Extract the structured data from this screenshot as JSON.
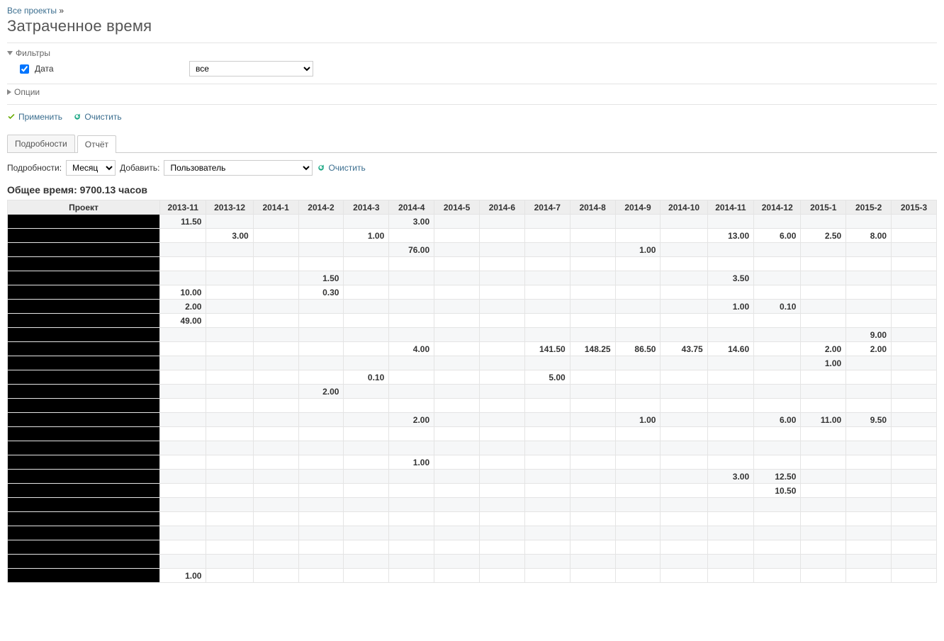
{
  "breadcrumb": {
    "link": "Все проекты",
    "sep": "»"
  },
  "page_title": "Затраченное время",
  "filters": {
    "legend": "Фильтры",
    "date_label": "Дата",
    "date_select_value": "все"
  },
  "options": {
    "legend": "Опции"
  },
  "actions": {
    "apply": "Применить",
    "clear": "Очистить"
  },
  "tabs": {
    "details": "Подробности",
    "report": "Отчёт"
  },
  "controls": {
    "details_label": "Подробности:",
    "details_value": "Месяц",
    "add_label": "Добавить:",
    "add_value": "Пользователь",
    "clear": "Очистить"
  },
  "total": {
    "label": "Общее время:",
    "value": "9700.13",
    "unit": "часов"
  },
  "table": {
    "project_header": "Проект",
    "columns": [
      "2013-11",
      "2013-12",
      "2014-1",
      "2014-2",
      "2014-3",
      "2014-4",
      "2014-5",
      "2014-6",
      "2014-7",
      "2014-8",
      "2014-9",
      "2014-10",
      "2014-11",
      "2014-12",
      "2015-1",
      "2015-2",
      "2015-3"
    ],
    "rows": [
      {
        "c": [
          "11.50",
          "",
          "",
          "",
          "",
          "3.00",
          "",
          "",
          "",
          "",
          "",
          "",
          "",
          "",
          "",
          "",
          ""
        ]
      },
      {
        "c": [
          "",
          "3.00",
          "",
          "",
          "1.00",
          "",
          "",
          "",
          "",
          "",
          "",
          "",
          "13.00",
          "6.00",
          "2.50",
          "8.00",
          ""
        ]
      },
      {
        "c": [
          "",
          "",
          "",
          "",
          "",
          "76.00",
          "",
          "",
          "",
          "",
          "1.00",
          "",
          "",
          "",
          "",
          "",
          ""
        ]
      },
      {
        "c": [
          "",
          "",
          "",
          "",
          "",
          "",
          "",
          "",
          "",
          "",
          "",
          "",
          "",
          "",
          "",
          "",
          ""
        ]
      },
      {
        "c": [
          "",
          "",
          "",
          "1.50",
          "",
          "",
          "",
          "",
          "",
          "",
          "",
          "",
          "3.50",
          "",
          "",
          "",
          ""
        ]
      },
      {
        "c": [
          "10.00",
          "",
          "",
          "0.30",
          "",
          "",
          "",
          "",
          "",
          "",
          "",
          "",
          "",
          "",
          "",
          "",
          ""
        ]
      },
      {
        "c": [
          "2.00",
          "",
          "",
          "",
          "",
          "",
          "",
          "",
          "",
          "",
          "",
          "",
          "1.00",
          "0.10",
          "",
          "",
          ""
        ]
      },
      {
        "c": [
          "49.00",
          "",
          "",
          "",
          "",
          "",
          "",
          "",
          "",
          "",
          "",
          "",
          "",
          "",
          "",
          "",
          ""
        ]
      },
      {
        "c": [
          "",
          "",
          "",
          "",
          "",
          "",
          "",
          "",
          "",
          "",
          "",
          "",
          "",
          "",
          "",
          "9.00",
          ""
        ]
      },
      {
        "c": [
          "",
          "",
          "",
          "",
          "",
          "4.00",
          "",
          "",
          "141.50",
          "148.25",
          "86.50",
          "43.75",
          "14.60",
          "",
          "2.00",
          "2.00",
          ""
        ]
      },
      {
        "c": [
          "",
          "",
          "",
          "",
          "",
          "",
          "",
          "",
          "",
          "",
          "",
          "",
          "",
          "",
          "1.00",
          "",
          ""
        ]
      },
      {
        "c": [
          "",
          "",
          "",
          "",
          "0.10",
          "",
          "",
          "",
          "5.00",
          "",
          "",
          "",
          "",
          "",
          "",
          "",
          ""
        ]
      },
      {
        "c": [
          "",
          "",
          "",
          "2.00",
          "",
          "",
          "",
          "",
          "",
          "",
          "",
          "",
          "",
          "",
          "",
          "",
          ""
        ]
      },
      {
        "c": [
          "",
          "",
          "",
          "",
          "",
          "",
          "",
          "",
          "",
          "",
          "",
          "",
          "",
          "",
          "",
          "",
          ""
        ]
      },
      {
        "c": [
          "",
          "",
          "",
          "",
          "",
          "2.00",
          "",
          "",
          "",
          "",
          "1.00",
          "",
          "",
          "6.00",
          "11.00",
          "9.50",
          ""
        ]
      },
      {
        "c": [
          "",
          "",
          "",
          "",
          "",
          "",
          "",
          "",
          "",
          "",
          "",
          "",
          "",
          "",
          "",
          "",
          ""
        ]
      },
      {
        "c": [
          "",
          "",
          "",
          "",
          "",
          "",
          "",
          "",
          "",
          "",
          "",
          "",
          "",
          "",
          "",
          "",
          ""
        ]
      },
      {
        "c": [
          "",
          "",
          "",
          "",
          "",
          "1.00",
          "",
          "",
          "",
          "",
          "",
          "",
          "",
          "",
          "",
          "",
          ""
        ]
      },
      {
        "c": [
          "",
          "",
          "",
          "",
          "",
          "",
          "",
          "",
          "",
          "",
          "",
          "",
          "3.00",
          "12.50",
          "",
          "",
          ""
        ]
      },
      {
        "c": [
          "",
          "",
          "",
          "",
          "",
          "",
          "",
          "",
          "",
          "",
          "",
          "",
          "",
          "10.50",
          "",
          "",
          ""
        ]
      },
      {
        "c": [
          "",
          "",
          "",
          "",
          "",
          "",
          "",
          "",
          "",
          "",
          "",
          "",
          "",
          "",
          "",
          "",
          ""
        ]
      },
      {
        "c": [
          "",
          "",
          "",
          "",
          "",
          "",
          "",
          "",
          "",
          "",
          "",
          "",
          "",
          "",
          "",
          "",
          ""
        ]
      },
      {
        "c": [
          "",
          "",
          "",
          "",
          "",
          "",
          "",
          "",
          "",
          "",
          "",
          "",
          "",
          "",
          "",
          "",
          ""
        ]
      },
      {
        "c": [
          "",
          "",
          "",
          "",
          "",
          "",
          "",
          "",
          "",
          "",
          "",
          "",
          "",
          "",
          "",
          "",
          ""
        ]
      },
      {
        "c": [
          "",
          "",
          "",
          "",
          "",
          "",
          "",
          "",
          "",
          "",
          "",
          "",
          "",
          "",
          "",
          "",
          ""
        ]
      },
      {
        "c": [
          "1.00",
          "",
          "",
          "",
          "",
          "",
          "",
          "",
          "",
          "",
          "",
          "",
          "",
          "",
          "",
          "",
          ""
        ]
      }
    ]
  }
}
